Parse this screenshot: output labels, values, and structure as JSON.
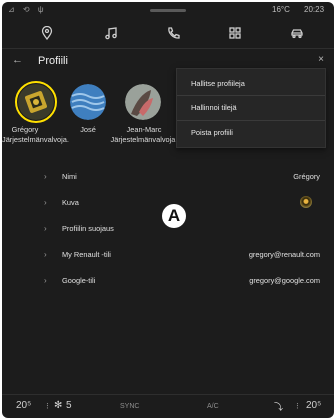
{
  "status_bar": {
    "icons": [
      "signal-icon",
      "sync-icon",
      "usb-icon"
    ],
    "temperature": "16°C",
    "time": "20:23"
  },
  "top_nav": {
    "icons": [
      "location-pin-icon",
      "music-icon",
      "phone-icon",
      "apps-grid-icon",
      "car-icon"
    ]
  },
  "header": {
    "title": "Profiili",
    "back_symbol": "←",
    "close_symbol": "×"
  },
  "profiles": [
    {
      "name": "Grégory",
      "role": "Järjestelmänvalvoja.",
      "selected": true
    },
    {
      "name": "José",
      "role": ""
    },
    {
      "name": "Jean-Marc",
      "role": "Järjestelmänvalvoja."
    }
  ],
  "menu": {
    "items": [
      "Hallitse profiileja",
      "Hallinnoi tilejä",
      "Poista profiili"
    ]
  },
  "settings": {
    "rows": [
      {
        "label": "Nimi",
        "value": "Grégory"
      },
      {
        "label": "Kuva",
        "value": ""
      },
      {
        "label": "Profiilin suojaus",
        "value": ""
      },
      {
        "label": "My Renault -tili",
        "value": "gregory@renault.com"
      },
      {
        "label": "Google-tili",
        "value": "gregory@google.com"
      }
    ]
  },
  "marker": "A",
  "bottom_bar": {
    "temp_left": "20⁵",
    "fan_left": "5",
    "sync": "SYNC",
    "ac": "A/C",
    "temp_right": "20⁵"
  },
  "colors": {
    "background": "#1c1c1c",
    "menu_bg": "#262626",
    "accent": "#ffe000"
  }
}
